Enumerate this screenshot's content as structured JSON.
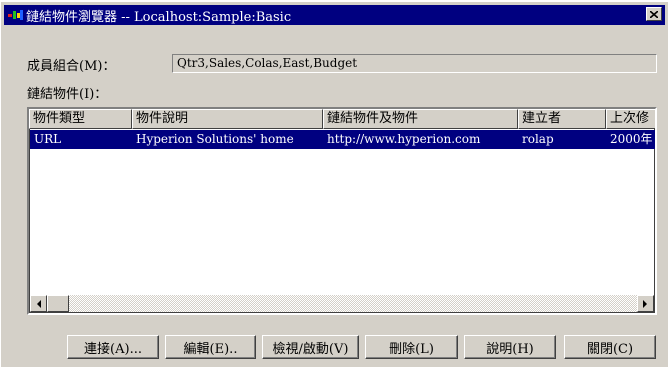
{
  "window": {
    "title": "鏈結物件瀏覽器 -- Localhost:Sample:Basic",
    "close_glyph": "✕"
  },
  "member_combo": {
    "label": "成員組合(M)：",
    "value": "Qtr3,Sales,Colas,East,Budget"
  },
  "linked_objects": {
    "label": "鏈結物件(I)：",
    "columns": [
      "物件類型",
      "物件說明",
      "鏈結物件及物件",
      "建立者",
      "上次修"
    ],
    "rows": [
      [
        "URL",
        "Hyperion Solutions' home",
        "http://www.hyperion.com",
        "rolap",
        "2000年"
      ]
    ]
  },
  "buttons": {
    "connect": "連接(A)...",
    "edit": "編輯(E)..",
    "view_launch": "檢視/啟動(V)",
    "delete": "刪除(L)",
    "help": "說明(H)",
    "close": "關閉(C)"
  },
  "colors": {
    "title_bar": "#000080",
    "window_face": "#d4d0c8",
    "selection": "#000080"
  }
}
